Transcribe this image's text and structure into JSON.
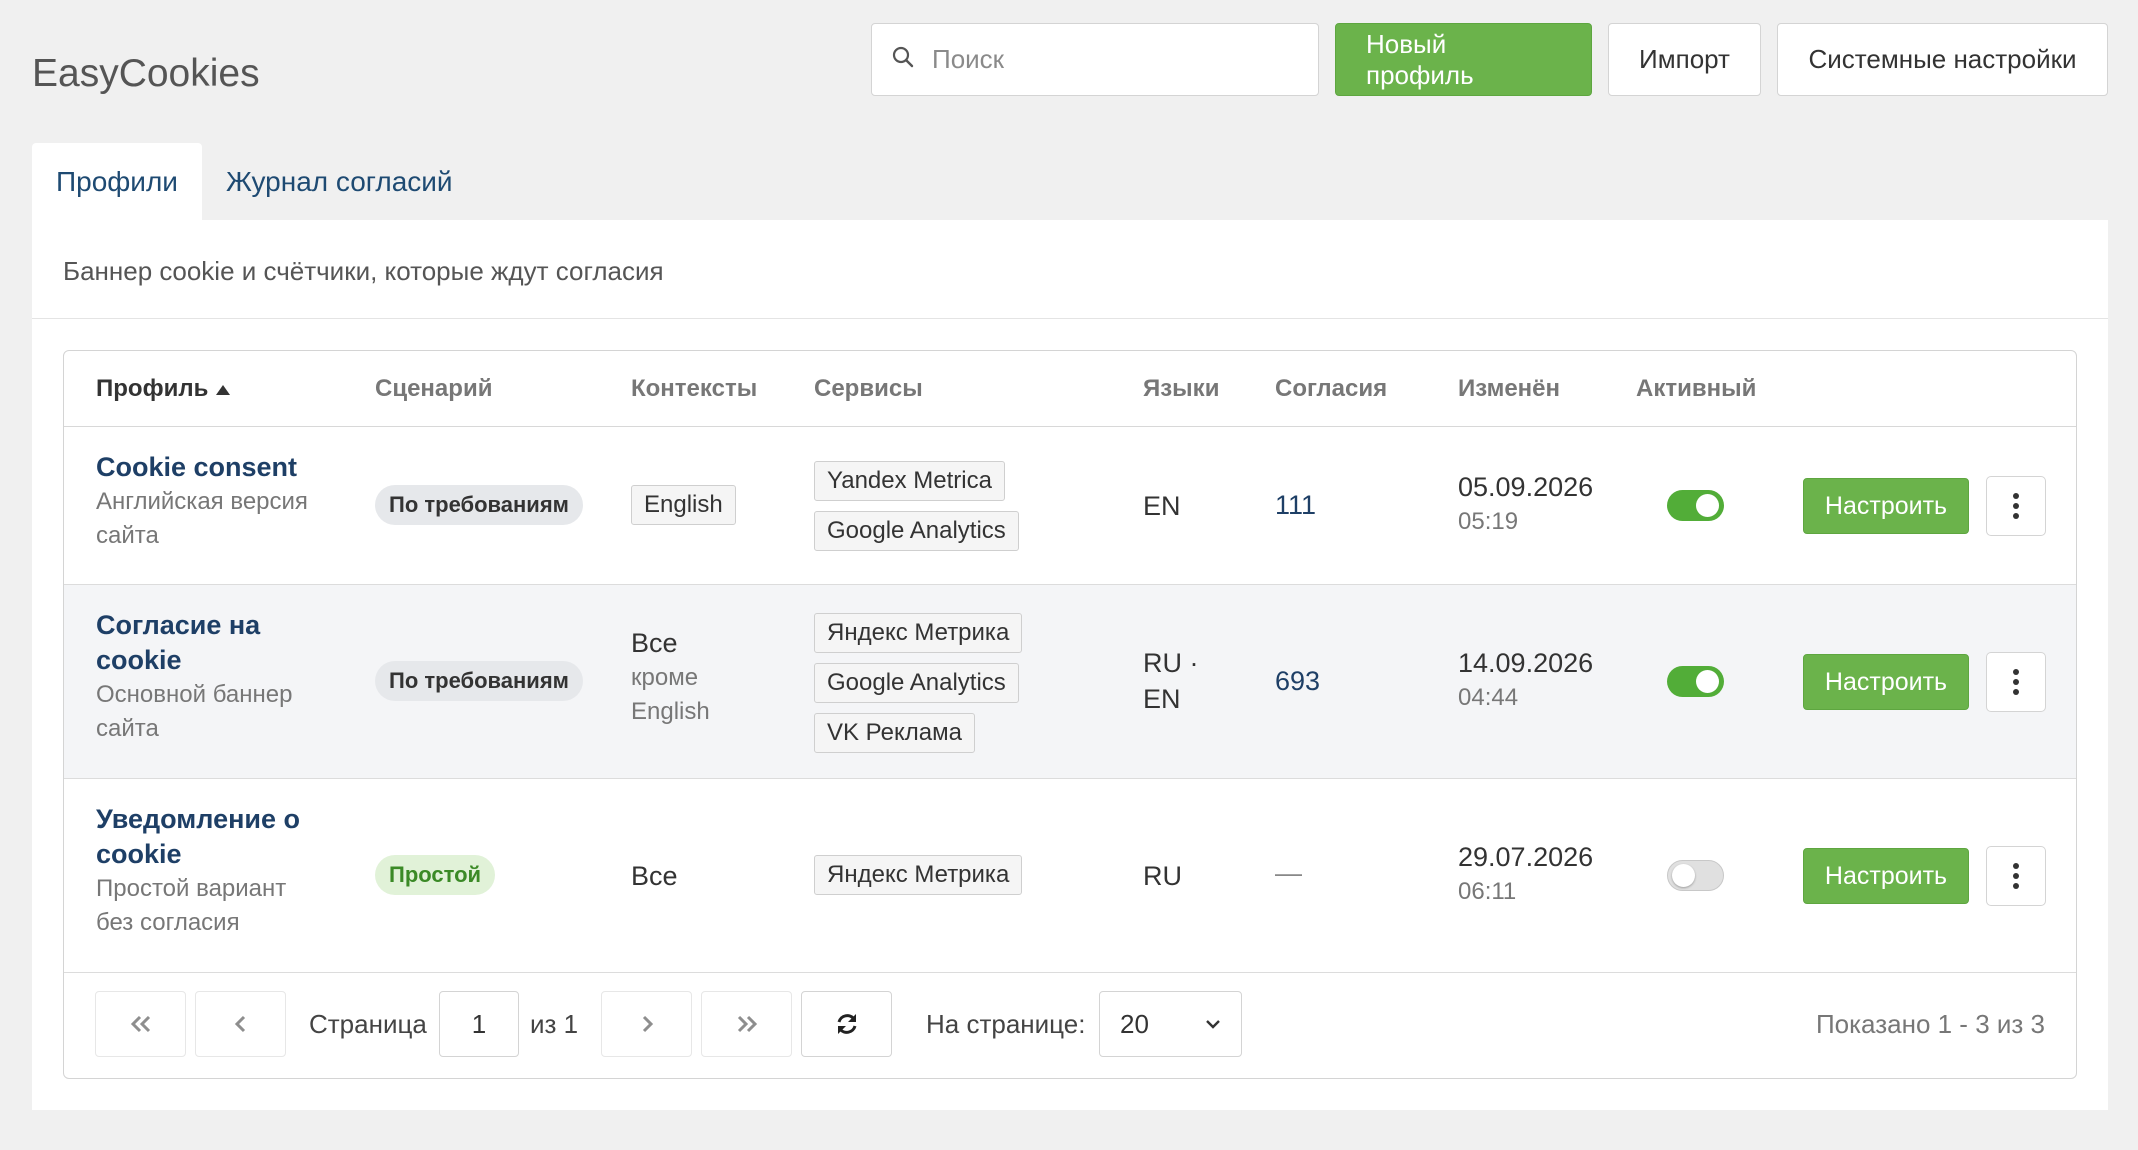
{
  "app": {
    "title": "EasyCookies"
  },
  "search": {
    "placeholder": "Поиск"
  },
  "actions": {
    "new_profile": "Новый профиль",
    "import": "Импорт",
    "system_settings": "Системные настройки"
  },
  "tabs": [
    {
      "label": "Профили",
      "active": true
    },
    {
      "label": "Журнал согласий",
      "active": false
    }
  ],
  "panel": {
    "description": "Баннер cookie и счётчики, которые ждут согласия"
  },
  "table": {
    "columns": [
      "Профиль",
      "Сценарий",
      "Контексты",
      "Сервисы",
      "Языки",
      "Согласия",
      "Изменён",
      "Активный"
    ],
    "sorted_column": "Профиль",
    "sort_direction": "asc",
    "rows": [
      {
        "name": "Cookie consent",
        "description": "Английская версия сайта",
        "scenario": "По требованиям",
        "scenario_style": "gray",
        "contexts_tag": "English",
        "services": [
          "Yandex Metrica",
          "Google Analytics"
        ],
        "languages": "EN",
        "consents": "111",
        "date": "05.09.2026",
        "time": "05:19",
        "active": true,
        "configure_label": "Настроить"
      },
      {
        "name": "Согласие на cookie",
        "description": "Основной баннер сайта",
        "scenario": "По требованиям",
        "scenario_style": "gray",
        "contexts_main": "Все",
        "contexts_sub": "кроме English",
        "services": [
          "Яндекс Метрика",
          "Google Analytics",
          "VK Реклама"
        ],
        "languages": "RU · EN",
        "consents": "693",
        "date": "14.09.2026",
        "time": "04:44",
        "active": true,
        "configure_label": "Настроить"
      },
      {
        "name": "Уведомление о cookie",
        "description": "Простой вариант без согласия",
        "scenario": "Простой",
        "scenario_style": "green",
        "contexts_main": "Все",
        "services": [
          "Яндекс Метрика"
        ],
        "languages": "RU",
        "consents": "—",
        "date": "29.07.2026",
        "time": "06:11",
        "active": false,
        "configure_label": "Настроить"
      }
    ]
  },
  "pagination": {
    "page_label": "Страница",
    "current_page": "1",
    "of_label": "из 1",
    "per_page_label": "На странице:",
    "per_page_value": "20",
    "summary": "Показано 1 - 3 из 3"
  },
  "colors": {
    "accent_green": "#6bb34b",
    "link_blue": "#1e3f66",
    "background": "#f0f0f0"
  },
  "icons": [
    "search-icon",
    "sort-asc-icon",
    "kebab-menu-icon",
    "first-page-icon",
    "prev-page-icon",
    "next-page-icon",
    "last-page-icon",
    "refresh-icon",
    "chevron-down-icon"
  ]
}
